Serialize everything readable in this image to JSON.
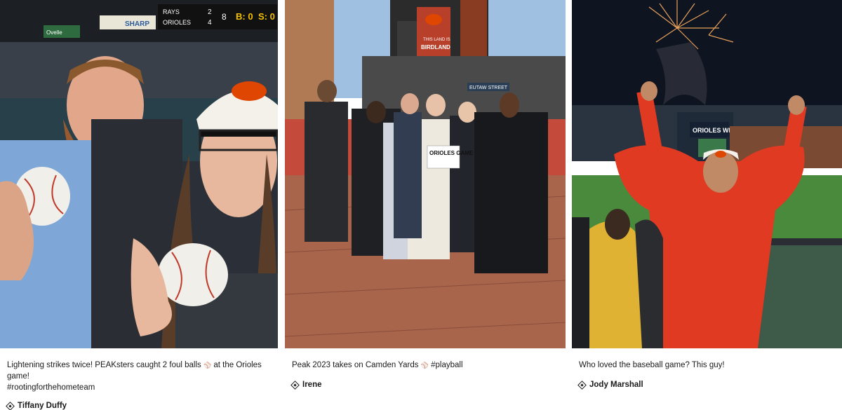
{
  "posts": [
    {
      "caption_parts": [
        "Lightening strikes twice! PEAKsters caught 2 foul balls ",
        "⚾",
        " at the Orioles game!"
      ],
      "caption_line2": "#rootingforthehometeam",
      "author": "Tiffany Duffy",
      "photo": {
        "scoreboard_team_1": "RAYS",
        "scoreboard_team_2": "ORIOLES",
        "scoreboard_score_1": "2",
        "scoreboard_score_2": "4",
        "scoreboard_count": "8",
        "scoreboard_balls": "B: 0",
        "scoreboard_strikes": "S: 0",
        "sign_1": "SHARP",
        "sign_2": "Ovelle"
      }
    },
    {
      "caption_parts": [
        "Peak 2023 takes on Camden Yards ",
        "⚾",
        " #playball"
      ],
      "author": "Irene",
      "photo": {
        "sign_card": "ORIOLES GAME",
        "stadium_sign": "BIRDLAND",
        "stadium_sign_top": "THIS LAND IS",
        "street_sign": "EUTAW STREET"
      }
    },
    {
      "caption_parts": [
        "Who loved the baseball game? This guy!"
      ],
      "author": "Jody Marshall",
      "photo": {
        "scoreboard_label": "ORIOLES WIN"
      }
    }
  ],
  "colors": {
    "orioles_orange": "#df4601",
    "text": "#1a1a1a"
  }
}
